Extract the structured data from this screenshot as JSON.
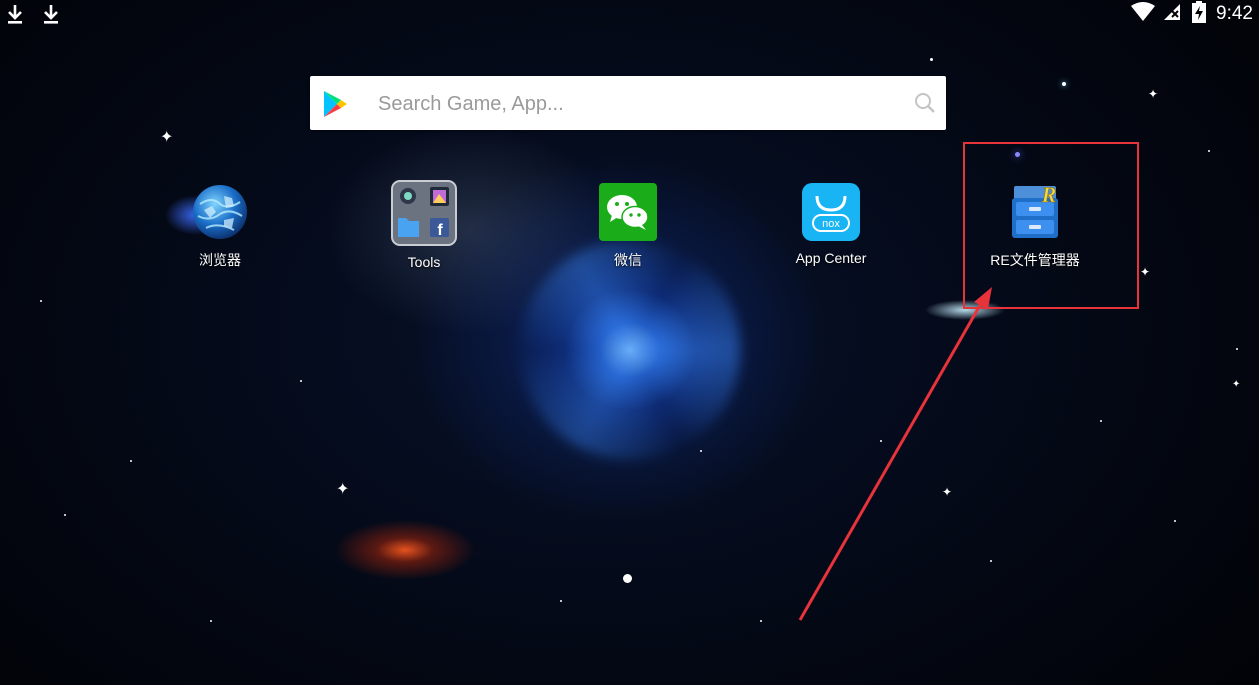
{
  "status_bar": {
    "time": "9:42",
    "left_icons": [
      "download-icon",
      "download-icon"
    ],
    "right_icons": [
      "wifi-icon",
      "no-sim-icon",
      "battery-charging-icon"
    ]
  },
  "search": {
    "placeholder": "Search Game, App...",
    "value": "",
    "left_icon": "play-store-icon",
    "right_icon": "search-icon"
  },
  "apps": [
    {
      "label": "浏览器",
      "icon": "globe-icon"
    },
    {
      "label": "Tools",
      "icon": "folder-icon"
    },
    {
      "label": "微信",
      "icon": "wechat-icon"
    },
    {
      "label": "App Center",
      "icon": "nox-app-center-icon"
    },
    {
      "label": "RE文件管理器",
      "icon": "re-file-manager-icon"
    }
  ],
  "annotation": {
    "highlight": "RE文件管理器",
    "color": "#e8333a"
  },
  "pager": {
    "pages": 1,
    "current": 1
  }
}
